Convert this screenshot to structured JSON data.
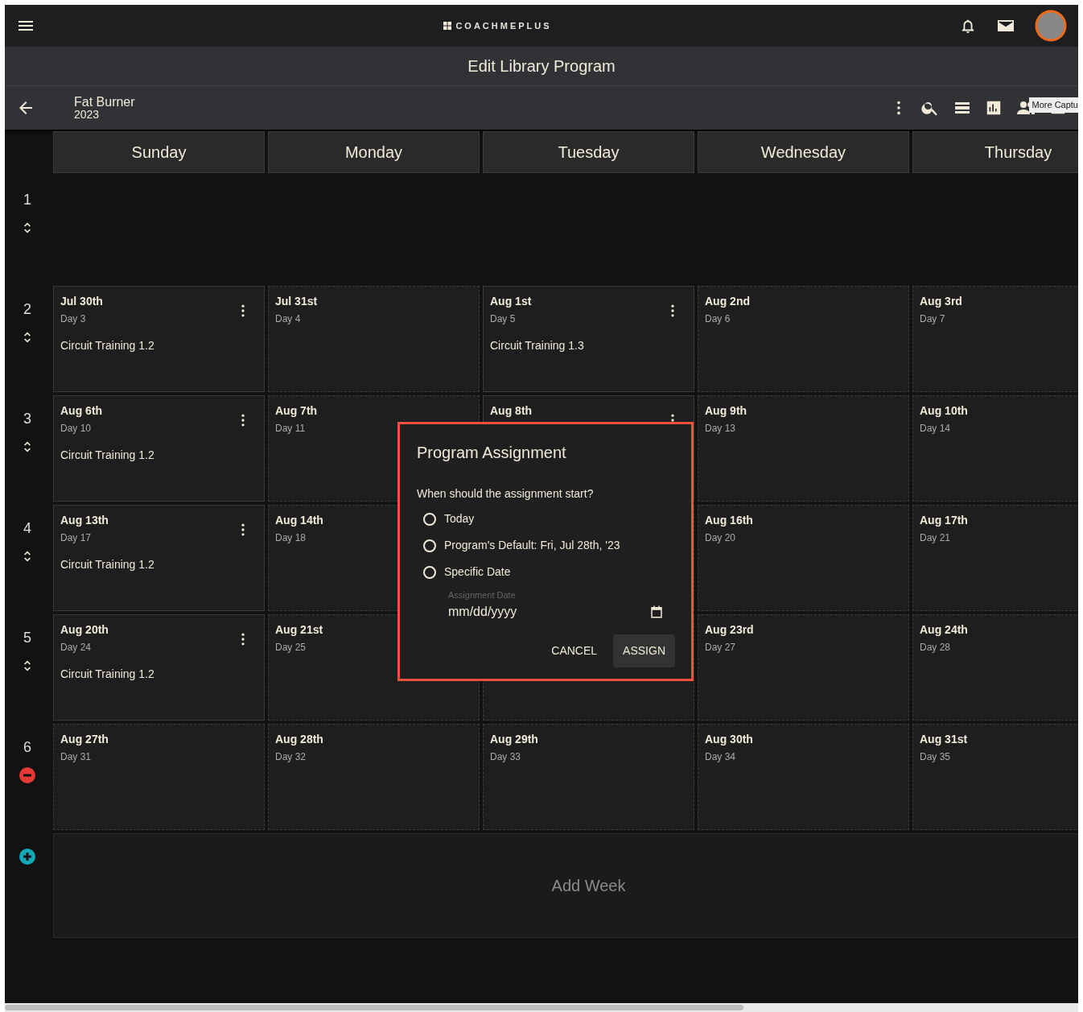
{
  "app": {
    "logo": "COACHMEPLUS"
  },
  "page_title": "Edit Library Program",
  "program": {
    "name": "Fat Burner",
    "year": "2023"
  },
  "tooltip": "More Captu",
  "days": [
    "Sunday",
    "Monday",
    "Tuesday",
    "Wednesday",
    "Thursday"
  ],
  "weeks": [
    {
      "number": "1",
      "kind": "reorder"
    },
    {
      "number": "2",
      "kind": "reorder",
      "cells": [
        {
          "kind": "workout",
          "date": "Jul 30th",
          "day": "Day 3",
          "workout": "Circuit Training 1.2"
        },
        {
          "kind": "empty",
          "date": "Jul 31st",
          "day": "Day 4"
        },
        {
          "kind": "workout",
          "date": "Aug 1st",
          "day": "Day 5",
          "workout": "Circuit Training 1.3"
        },
        {
          "kind": "empty",
          "date": "Aug 2nd",
          "day": "Day 6"
        },
        {
          "kind": "empty",
          "date": "Aug 3rd",
          "day": "Day 7"
        }
      ]
    },
    {
      "number": "3",
      "kind": "reorder",
      "cells": [
        {
          "kind": "workout",
          "date": "Aug 6th",
          "day": "Day 10",
          "workout": "Circuit Training 1.2"
        },
        {
          "kind": "empty",
          "date": "Aug 7th",
          "day": "Day 11"
        },
        {
          "kind": "workout",
          "date": "Aug 8th"
        },
        {
          "kind": "empty",
          "date": "Aug 9th",
          "day": "Day 13"
        },
        {
          "kind": "empty",
          "date": "Aug 10th",
          "day": "Day 14"
        }
      ]
    },
    {
      "number": "4",
      "kind": "reorder",
      "cells": [
        {
          "kind": "workout",
          "date": "Aug 13th",
          "day": "Day 17",
          "workout": "Circuit Training 1.2"
        },
        {
          "kind": "empty",
          "date": "Aug 14th",
          "day": "Day 18"
        },
        {
          "kind": "covered"
        },
        {
          "kind": "empty",
          "date": "Aug 16th",
          "day": "Day 20"
        },
        {
          "kind": "empty",
          "date": "Aug 17th",
          "day": "Day 21"
        }
      ]
    },
    {
      "number": "5",
      "kind": "reorder",
      "cells": [
        {
          "kind": "workout",
          "date": "Aug 20th",
          "day": "Day 24",
          "workout": "Circuit Training 1.2"
        },
        {
          "kind": "empty",
          "date": "Aug 21st",
          "day": "Day 25"
        },
        {
          "kind": "covered"
        },
        {
          "kind": "empty",
          "date": "Aug 23rd",
          "day": "Day 27"
        },
        {
          "kind": "empty",
          "date": "Aug 24th",
          "day": "Day 28"
        }
      ]
    },
    {
      "number": "6",
      "kind": "remove",
      "cells": [
        {
          "kind": "empty",
          "date": "Aug 27th",
          "day": "Day 31"
        },
        {
          "kind": "empty",
          "date": "Aug 28th",
          "day": "Day 32"
        },
        {
          "kind": "empty",
          "date": "Aug 29th",
          "day": "Day 33"
        },
        {
          "kind": "empty",
          "date": "Aug 30th",
          "day": "Day 34"
        },
        {
          "kind": "empty",
          "date": "Aug 31st",
          "day": "Day 35"
        }
      ]
    }
  ],
  "add_week": "Add Week",
  "dialog": {
    "title": "Program Assignment",
    "question": "When should the assignment start?",
    "options": [
      {
        "label": "Today",
        "selected": false
      },
      {
        "label": "Program's Default: Fri, Jul 28th, '23",
        "selected": false
      },
      {
        "label": "Specific Date",
        "selected": false
      }
    ],
    "date_field": {
      "label": "Assignment Date",
      "placeholder": "mm/dd/yyyy"
    },
    "buttons": [
      "CANCEL",
      "ASSIGN"
    ]
  }
}
